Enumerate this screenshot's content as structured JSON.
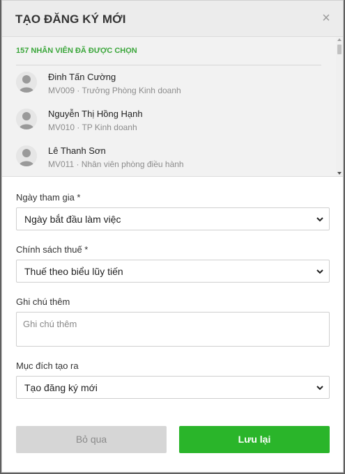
{
  "dialog": {
    "title": "TẠO ĐĂNG KÝ MỚI",
    "close_label": "×"
  },
  "employees": {
    "count_label": "157 NHÂN VIÊN ĐÃ ĐƯỢC CHỌN",
    "items": [
      {
        "name": "Đinh Tấn Cường",
        "meta": "MV009 · Trưởng Phòng Kinh doanh"
      },
      {
        "name": "Nguyễn Thị Hồng Hạnh",
        "meta": "MV010 · TP Kinh doanh"
      },
      {
        "name": "Lê Thanh Sơn",
        "meta": "MV011 · Nhân viên phòng điều hành"
      }
    ]
  },
  "form": {
    "join_date": {
      "label": "Ngày tham gia *",
      "value": "Ngày bắt đầu làm việc"
    },
    "tax_policy": {
      "label": "Chính sách thuế *",
      "value": "Thuế theo biểu lũy tiến"
    },
    "note": {
      "label": "Ghi chú thêm",
      "placeholder": "Ghi chú thêm"
    },
    "purpose": {
      "label": "Mục đích tạo ra",
      "value": "Tạo đăng ký mới"
    }
  },
  "actions": {
    "cancel_label": "Bỏ qua",
    "save_label": "Lưu lại"
  },
  "colors": {
    "accent": "#2ab52a",
    "count_text": "#3aa63a",
    "cancel_bg": "#d6d6d6"
  },
  "icons": {
    "close": "close-icon",
    "avatar": "user-silhouette-icon",
    "select_caret": "chevron-down-icon"
  }
}
